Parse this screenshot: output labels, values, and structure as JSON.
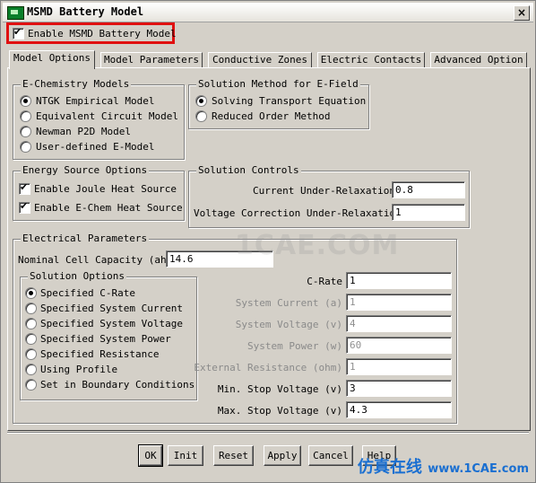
{
  "window": {
    "title": "MSMD Battery Model",
    "close_glyph": "×"
  },
  "enable": {
    "label": "Enable MSMD Battery Model",
    "checked": true
  },
  "tabs": [
    {
      "label": "Model Options",
      "active": true
    },
    {
      "label": "Model Parameters",
      "active": false
    },
    {
      "label": "Conductive Zones",
      "active": false
    },
    {
      "label": "Electric Contacts",
      "active": false
    },
    {
      "label": "Advanced Option",
      "active": false
    }
  ],
  "echem": {
    "title": "E-Chemistry Models",
    "options": [
      "NTGK Empirical Model",
      "Equivalent Circuit Model",
      "Newman P2D Model",
      "User-defined E-Model"
    ],
    "selected": 0
  },
  "efield": {
    "title": "Solution Method for E-Field",
    "options": [
      "Solving Transport Equation",
      "Reduced Order Method"
    ],
    "selected": 0
  },
  "energy": {
    "title": "Energy Source Options",
    "options": [
      "Enable Joule Heat Source",
      "Enable E-Chem Heat Source"
    ]
  },
  "controls": {
    "title": "Solution Controls",
    "current_label": "Current Under-Relaxation",
    "current_value": "0.8",
    "voltage_label": "Voltage Correction Under-Relaxation",
    "voltage_value": "1"
  },
  "electrical": {
    "title": "Electrical Parameters",
    "capacity_label": "Nominal Cell Capacity  (ah)",
    "capacity_value": "14.6"
  },
  "solution_options": {
    "title": "Solution Options",
    "options": [
      "Specified C-Rate",
      "Specified System Current",
      "Specified System Voltage",
      "Specified System Power",
      "Specified Resistance",
      "Using Profile",
      "Set in Boundary Conditions"
    ],
    "selected": 0
  },
  "params": [
    {
      "label": "C-Rate",
      "value": "1",
      "enabled": true
    },
    {
      "label": "System Current  (a)",
      "value": "1",
      "enabled": false
    },
    {
      "label": "System Voltage  (v)",
      "value": "4",
      "enabled": false
    },
    {
      "label": "System Power  (w)",
      "value": "60",
      "enabled": false
    },
    {
      "label": "External Resistance  (ohm)",
      "value": "1",
      "enabled": false
    },
    {
      "label": "Min. Stop Voltage  (v)",
      "value": "3",
      "enabled": true
    },
    {
      "label": "Max. Stop Voltage  (v)",
      "value": "4.3",
      "enabled": true
    }
  ],
  "buttons": [
    "OK",
    "Init",
    "Reset",
    "Apply",
    "Cancel",
    "Help"
  ],
  "watermark": "1CAE.COM",
  "watermark2": {
    "cn": "仿真在线",
    "site": "www.1CAE.com"
  },
  "colors": {
    "highlight": "#e01010",
    "face": "#d4d0c8"
  }
}
